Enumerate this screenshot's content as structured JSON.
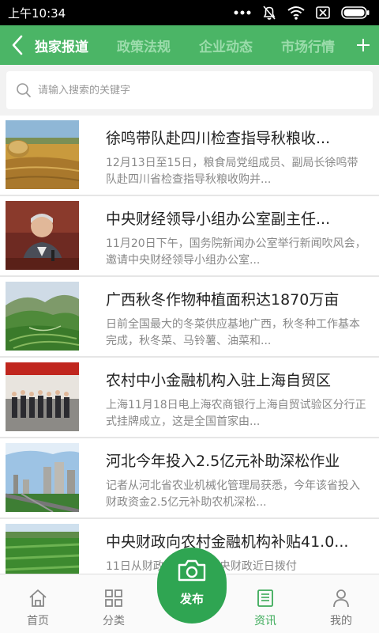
{
  "status_bar": {
    "time": "上午10:34"
  },
  "tabs": [
    "独家报道",
    "政策法规",
    "企业动态",
    "市场行情"
  ],
  "search": {
    "placeholder": "请输入搜索的关键字"
  },
  "news": [
    {
      "title": "徐鸣带队赴四川检查指导秋粮收...",
      "summary": "12月13日至15日，粮食局党组成员、副局长徐鸣带队赴四川省检查指导秋粮收购并..."
    },
    {
      "title": "中央财经领导小组办公室副主任...",
      "summary": "11月20日下午，国务院新闻办公室举行新闻吹风会，邀请中央财经领导小组办公室..."
    },
    {
      "title": "广西秋冬作物种植面积达1870万亩",
      "summary": "日前全国最大的冬菜供应基地广西，秋冬种工作基本完成，秋冬菜、马铃薯、油菜和..."
    },
    {
      "title": "农村中小金融机构入驻上海自贸区",
      "summary": "上海11月18日电上海农商银行上海自贸试验区分行正式挂牌成立，这是全国首家由..."
    },
    {
      "title": "河北今年投入2.5亿元补助深松作业",
      "summary": "记者从河北省农业机械化管理局获悉，今年该省投入财政资金2.5亿元补助农机深松..."
    },
    {
      "title": "中央财政向农村金融机构补贴41.0...",
      "summary": "11日从财政部获悉，中央财政近日拨付"
    }
  ],
  "bottom_nav": {
    "home": "首页",
    "category": "分类",
    "publish": "发布",
    "news": "资讯",
    "mine": "我的"
  },
  "colors": {
    "brand_green": "#4bb566",
    "publish_green": "#2fa552",
    "active_tab_text": "#ffffff",
    "inactive_tab_text": "#9bdcab"
  }
}
